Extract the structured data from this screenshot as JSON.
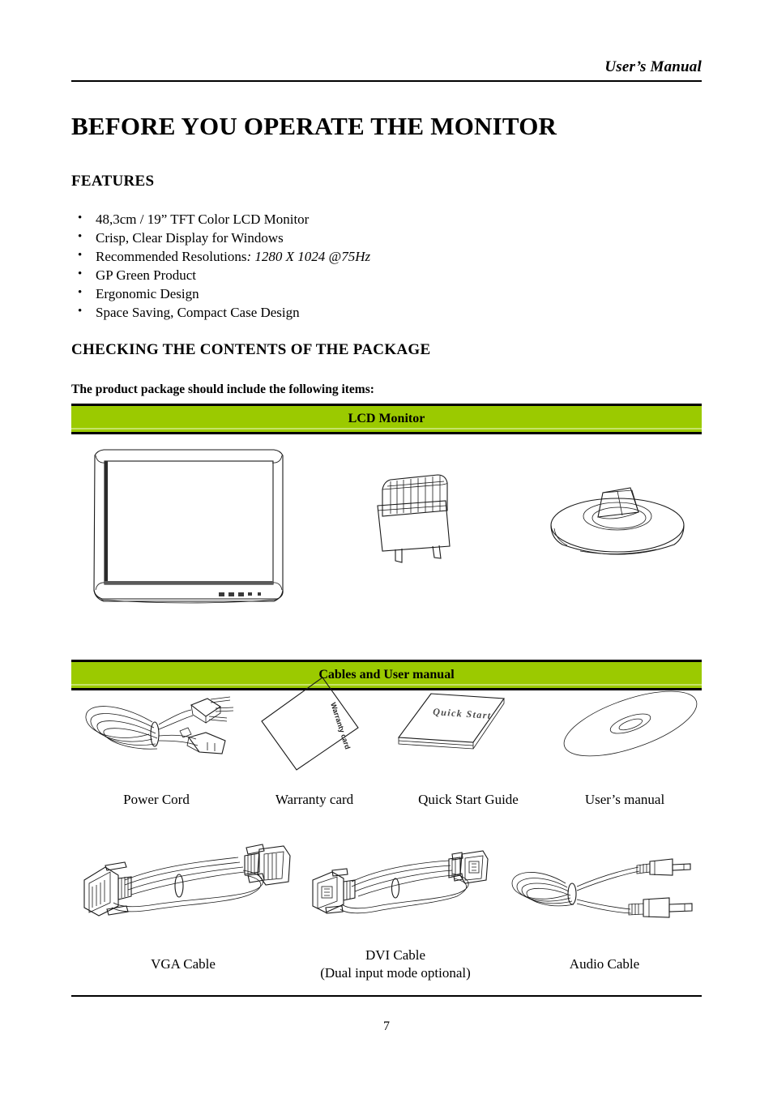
{
  "header": {
    "running_head": "User’s Manual"
  },
  "title": "BEFORE YOU OPERATE THE MONITOR",
  "sections": {
    "features_heading": "FEATURES",
    "checking_heading": "CHECKING THE CONTENTS OF THE PACKAGE",
    "package_subheading": "The product package should include the following items:"
  },
  "features": [
    {
      "text": "48,3cm / 19” TFT Color LCD Monitor",
      "emphasis": ""
    },
    {
      "text": "Crisp, Clear Display for Windows",
      "emphasis": ""
    },
    {
      "text": "Recommended Resolutions",
      "emphasis": ": 1280 X 1024 @75Hz"
    },
    {
      "text": "GP Green Product",
      "emphasis": ""
    },
    {
      "text": "Ergonomic Design",
      "emphasis": ""
    },
    {
      "text": "Space Saving, Compact Case Design",
      "emphasis": ""
    }
  ],
  "package": {
    "band_lcd": "LCD Monitor",
    "band_cables": "Cables and User manual",
    "accent_color": "#9bca00",
    "lcd_items": [
      {
        "icon": "lcd-monitor-illustration",
        "label": ""
      },
      {
        "icon": "monitor-stand-neck-illustration",
        "label": ""
      },
      {
        "icon": "monitor-stand-base-illustration",
        "label": ""
      }
    ],
    "accessory_row_1": [
      {
        "icon": "power-cord-illustration",
        "label": "Power Cord"
      },
      {
        "icon": "warranty-card-illustration",
        "label": "Warranty card",
        "card_text": "Warranty card"
      },
      {
        "icon": "quick-start-guide-illustration",
        "label": "Quick Start Guide",
        "cover_text": "Quick Start"
      },
      {
        "icon": "cd-disc-illustration",
        "label": "User’s manual"
      }
    ],
    "accessory_row_2": [
      {
        "icon": "vga-cable-illustration",
        "label": "VGA Cable",
        "sublabel": ""
      },
      {
        "icon": "dvi-cable-illustration",
        "label": "DVI Cable",
        "sublabel": "(Dual input mode optional)"
      },
      {
        "icon": "audio-cable-illustration",
        "label": "Audio Cable",
        "sublabel": ""
      }
    ]
  },
  "footer": {
    "page_number": "7"
  }
}
